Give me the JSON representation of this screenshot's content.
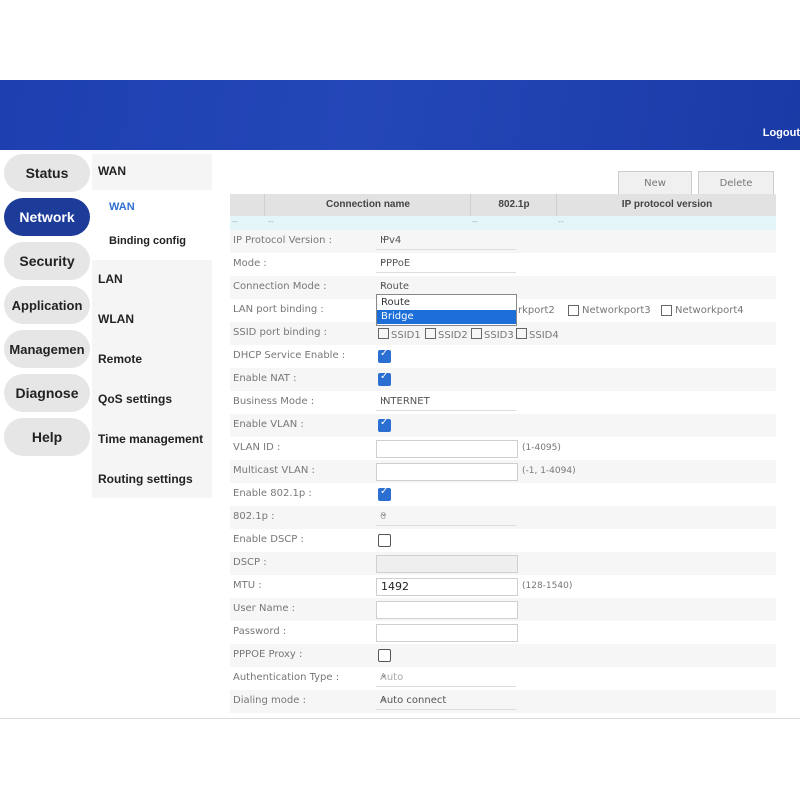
{
  "header": {
    "logout_label": "Logout"
  },
  "left_nav": [
    {
      "label": "Status"
    },
    {
      "label": "Network"
    },
    {
      "label": "Security"
    },
    {
      "label": "Application"
    },
    {
      "label": "Managemen"
    },
    {
      "label": "Diagnose"
    },
    {
      "label": "Help"
    }
  ],
  "sub_nav": {
    "wan": "WAN",
    "wan_link": "WAN",
    "binding": "Binding config",
    "items": [
      "LAN",
      "WLAN",
      "Remote",
      "QoS settings",
      "Time management",
      "Routing settings"
    ]
  },
  "toolbar": {
    "new_label": "New",
    "delete_label": "Delete"
  },
  "table": {
    "headers": [
      "Connection name",
      "802.1p",
      "IP protocol version"
    ],
    "row": [
      "--",
      "--",
      "--",
      "--"
    ]
  },
  "form": {
    "ip_protocol_label": "IP Protocol Version :",
    "ip_protocol_value": "IPv4",
    "mode_label": "Mode :",
    "mode_value": "PPPoE",
    "connection_mode_label": "Connection Mode :",
    "connection_mode_value": "Route",
    "lan_binding_label": "LAN port binding :",
    "lan_ports": [
      "rkport2",
      "Networkport3",
      "Networkport4"
    ],
    "ssid_binding_label": "SSID port binding :",
    "ssids": [
      "SSID1",
      "SSID2",
      "SSID3",
      "SSID4"
    ],
    "dhcp_label": "DHCP Service Enable :",
    "nat_label": "Enable NAT :",
    "business_label": "Business Mode :",
    "business_value": "INTERNET",
    "vlan_enable_label": "Enable VLAN :",
    "vlan_id_label": "VLAN ID :",
    "vlan_id_hint": "(1-4095)",
    "multicast_label": "Multicast VLAN :",
    "multicast_hint": "(-1, 1-4094)",
    "enable_8021p_label": "Enable 802.1p :",
    "p8021_label": "802.1p :",
    "p8021_value": "0",
    "dscp_enable_label": "Enable DSCP :",
    "dscp_label": "DSCP :",
    "mtu_label": "MTU :",
    "mtu_value": "1492",
    "mtu_hint": "(128-1540)",
    "user_label": "User Name :",
    "password_label": "Password :",
    "pppoe_proxy_label": "PPPOE Proxy :",
    "auth_label": "Authentication Type :",
    "auth_value": "Auto",
    "dial_label": "Dialing mode :",
    "dial_value": "Auto connect"
  },
  "dropdown": {
    "options": [
      "Route",
      "Bridge"
    ],
    "highlighted": "Bridge"
  },
  "colors": {
    "banner": "#1d3fb0",
    "active_nav": "#1d3c9a",
    "highlight": "#1c6fd8"
  }
}
